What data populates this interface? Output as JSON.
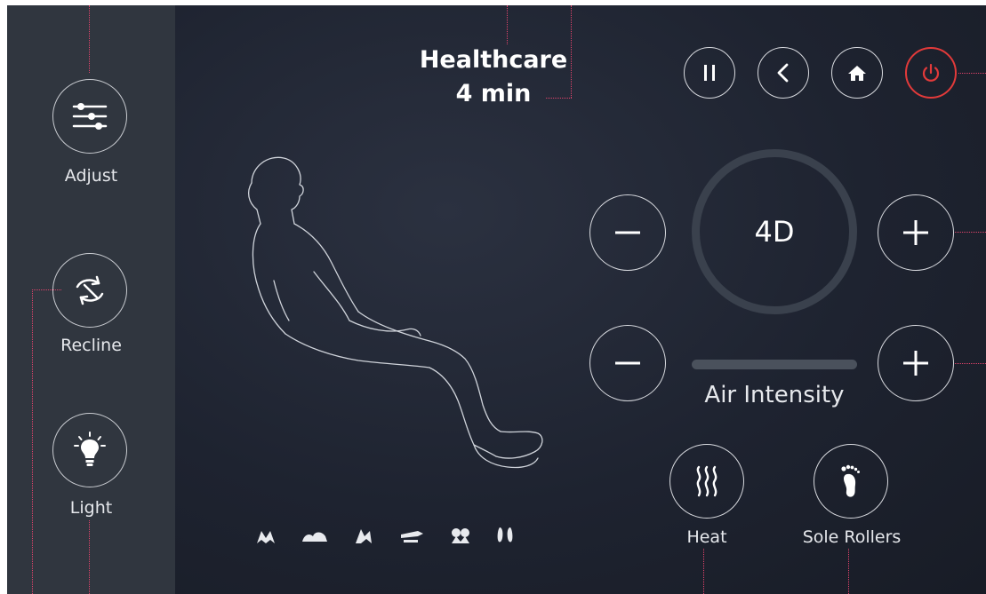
{
  "header": {
    "program": "Healthcare",
    "time": "4 min"
  },
  "sidebar": {
    "items": [
      {
        "label": "Adjust",
        "icon": "sliders-icon"
      },
      {
        "label": "Recline",
        "icon": "recline-arrows-icon"
      },
      {
        "label": "Light",
        "icon": "lightbulb-icon"
      }
    ]
  },
  "top_controls": [
    "pause-icon",
    "back-icon",
    "home-icon",
    "power-icon"
  ],
  "intensity": {
    "mode_label": "4D",
    "air_label": "Air Intensity"
  },
  "bottom": {
    "heat_label": "Heat",
    "sole_label": "Sole Rollers"
  },
  "massage_icons": [
    "hands-icon-1",
    "hands-icon-2",
    "hands-icon-3",
    "hands-icon-4",
    "hands-icon-5",
    "feet-icon"
  ],
  "colors": {
    "accent_power": "#e23a3a",
    "sidebar": "#30363f",
    "background": "#1e2330",
    "annotation": "#e0436b"
  }
}
